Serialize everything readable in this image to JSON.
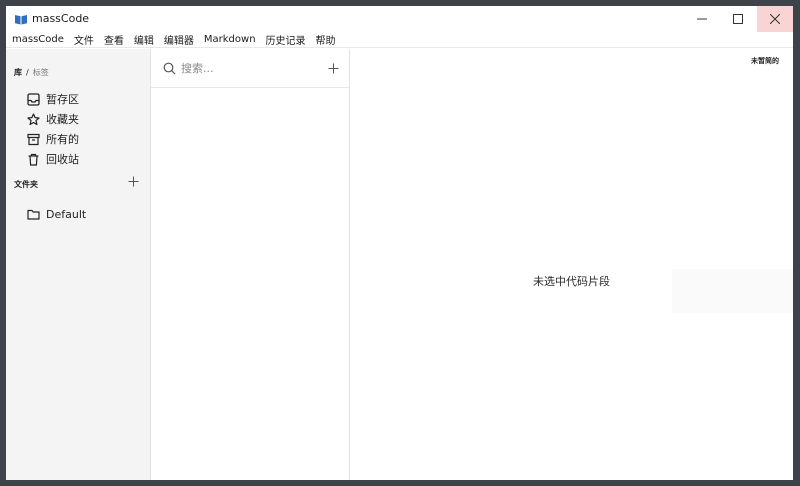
{
  "window": {
    "title": "massCode",
    "logo_icon": "book-icon",
    "controls": {
      "minimize": "minimize-icon",
      "maximize": "maximize-icon",
      "close": "close-icon"
    },
    "colors": {
      "close_hover": "#f9d4d4",
      "frame": "#3d4348"
    }
  },
  "menu": {
    "items": [
      "massCode",
      "文件",
      "查看",
      "编辑",
      "编辑器",
      "Markdown",
      "历史记录",
      "帮助"
    ]
  },
  "sidebar": {
    "breadcrumb": {
      "library": "库",
      "separator": "/",
      "tags": "标签"
    },
    "items": [
      {
        "label": "暂存区",
        "icon": "inbox-icon"
      },
      {
        "label": "收藏夹",
        "icon": "star-icon"
      },
      {
        "label": "所有的",
        "icon": "archive-icon"
      },
      {
        "label": "回收站",
        "icon": "trash-icon"
      }
    ],
    "folders_title": "文件夹",
    "folders": [
      {
        "label": "Default",
        "icon": "folder-icon"
      }
    ]
  },
  "list": {
    "search_placeholder": "搜索...",
    "search_value": ""
  },
  "editor": {
    "tag": "未暂简的",
    "empty_message": "未选中代码片段"
  }
}
